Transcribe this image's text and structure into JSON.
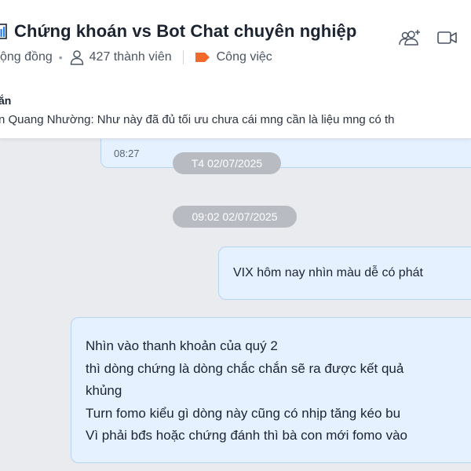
{
  "header": {
    "title": "Chứng khoán vs Bot Chat chuyên nghiệp",
    "community_label": "ộng đồng",
    "member_count": "427 thành viên",
    "category_label": "Công việc",
    "category_color": "#f2692b",
    "icons": [
      "chart-icon",
      "add-member-icon",
      "video-call-icon",
      "people-icon",
      "tag-icon"
    ]
  },
  "pinned": {
    "label": "ắn",
    "text": "n Quang Nhường: Như này đã đủ tối ưu chưa  cái mng cần là liệu mng có th"
  },
  "chat": {
    "prev_message_time": "08:27",
    "date_separator": "T4 02/07/2025",
    "time_separator": "09:02 02/07/2025",
    "sent_message": "VIX hôm nay nhìn màu dễ có phát",
    "received_message_lines": [
      "Nhìn vào thanh khoản của quý 2",
      "thì dòng chứng là dòng chắc chắn sẽ ra được kết quả",
      "khủng",
      "Turn fomo kiểu gì dòng này cũng có nhịp tăng kéo bu",
      "Vì phải bđs hoặc chứng đánh thì bà con mới fomo vào"
    ]
  }
}
